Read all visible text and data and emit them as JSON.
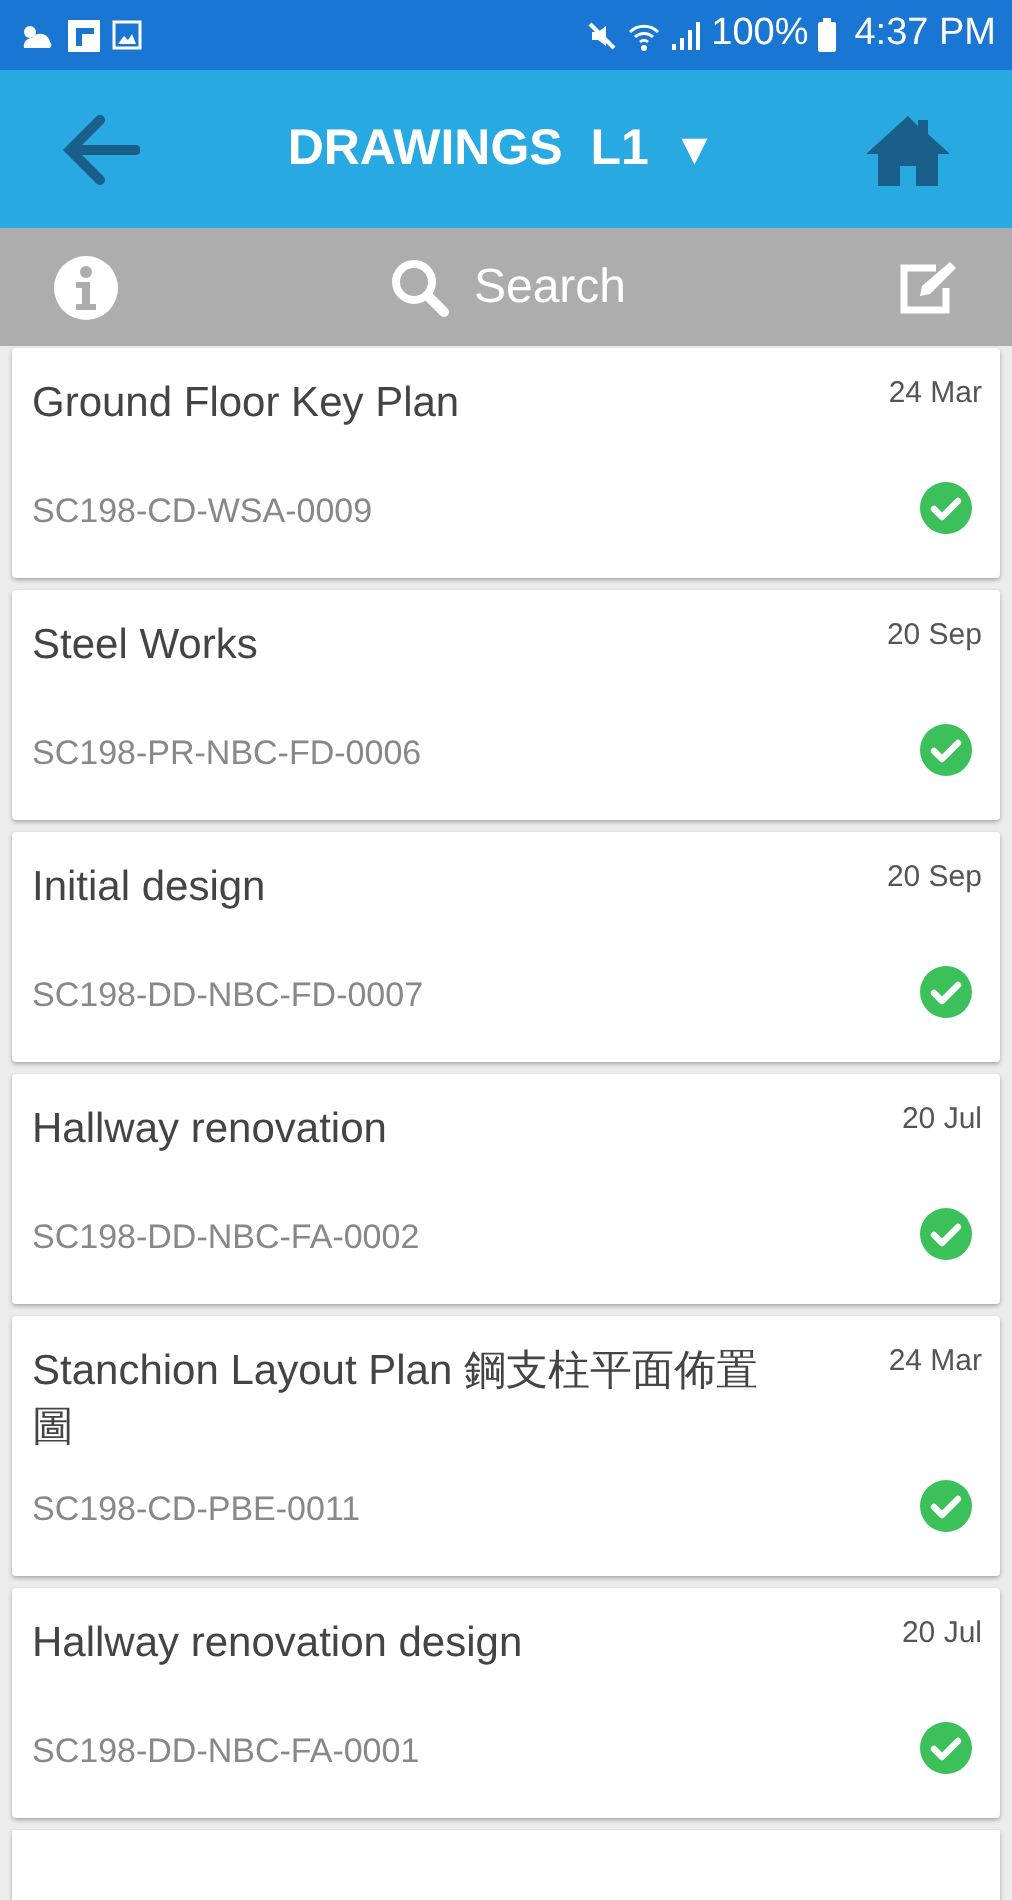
{
  "status_bar": {
    "battery": "100%",
    "time": "4:37 PM"
  },
  "header": {
    "title": "DRAWINGS  L1",
    "dropdown": "▼"
  },
  "toolbar": {
    "search": {
      "placeholder": "Search"
    }
  },
  "drawings": [
    {
      "title": "Ground Floor Key Plan",
      "code": "SC198-CD-WSA-0009",
      "date": "24 Mar",
      "checked": true
    },
    {
      "title": "Steel Works",
      "code": "SC198-PR-NBC-FD-0006",
      "date": "20 Sep",
      "checked": true
    },
    {
      "title": "Initial design",
      "code": "SC198-DD-NBC-FD-0007",
      "date": "20 Sep",
      "checked": true
    },
    {
      "title": "Hallway renovation",
      "code": "SC198-DD-NBC-FA-0002",
      "date": "20 Jul",
      "checked": true
    },
    {
      "title": "Stanchion Layout Plan  鋼支柱平面佈置圖",
      "code": "SC198-CD-PBE-0011",
      "date": "24 Mar",
      "checked": true
    },
    {
      "title": "Hallway renovation design",
      "code": "SC198-DD-NBC-FA-0001",
      "date": "20 Jul",
      "checked": true
    }
  ]
}
